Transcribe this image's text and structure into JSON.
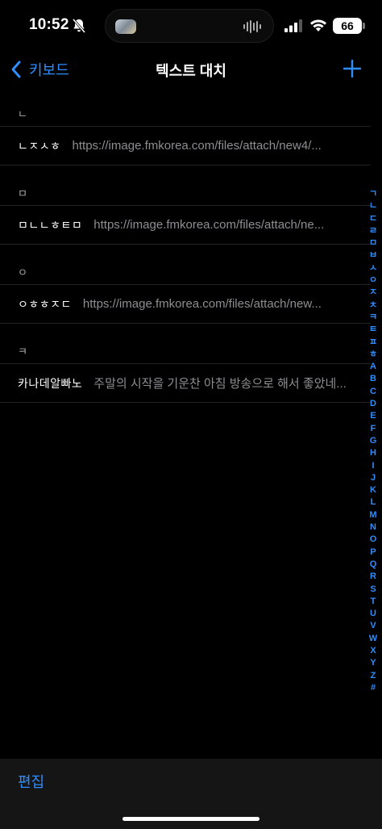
{
  "status_bar": {
    "time": "10:52",
    "battery": "66"
  },
  "nav": {
    "back_label": "키보드",
    "title": "텍스트 대치"
  },
  "sections": [
    {
      "header": "ㄴ",
      "rows": [
        {
          "phrase": "ㄴㅈㅅㅎ",
          "shortcut": "https://image.fmkorea.com/files/attach/new4/..."
        }
      ]
    },
    {
      "header": "ㅁ",
      "rows": [
        {
          "phrase": "ㅁㄴㄴㅎㅌㅁ",
          "shortcut": "https://image.fmkorea.com/files/attach/ne..."
        }
      ]
    },
    {
      "header": "ㅇ",
      "rows": [
        {
          "phrase": "ㅇㅎㅎㅈㄷ",
          "shortcut": "https://image.fmkorea.com/files/attach/new..."
        }
      ]
    },
    {
      "header": "ㅋ",
      "rows": [
        {
          "phrase": "카나데알빠노",
          "shortcut": "주말의 시작을 기운찬 아침 방송으로 해서 좋았네..."
        }
      ]
    }
  ],
  "index_letters": [
    "ㄱ",
    "ㄴ",
    "ㄷ",
    "ㄹ",
    "ㅁ",
    "ㅂ",
    "ㅅ",
    "ㅇ",
    "ㅈ",
    "ㅊ",
    "ㅋ",
    "ㅌ",
    "ㅍ",
    "ㅎ",
    "A",
    "B",
    "C",
    "D",
    "E",
    "F",
    "G",
    "H",
    "I",
    "J",
    "K",
    "L",
    "M",
    "N",
    "O",
    "P",
    "Q",
    "R",
    "S",
    "T",
    "U",
    "V",
    "W",
    "X",
    "Y",
    "Z",
    "#"
  ],
  "toolbar": {
    "edit_label": "편집"
  },
  "colors": {
    "accent": "#2f8dfc",
    "background": "#000000",
    "secondary_text": "#8e8e93"
  }
}
